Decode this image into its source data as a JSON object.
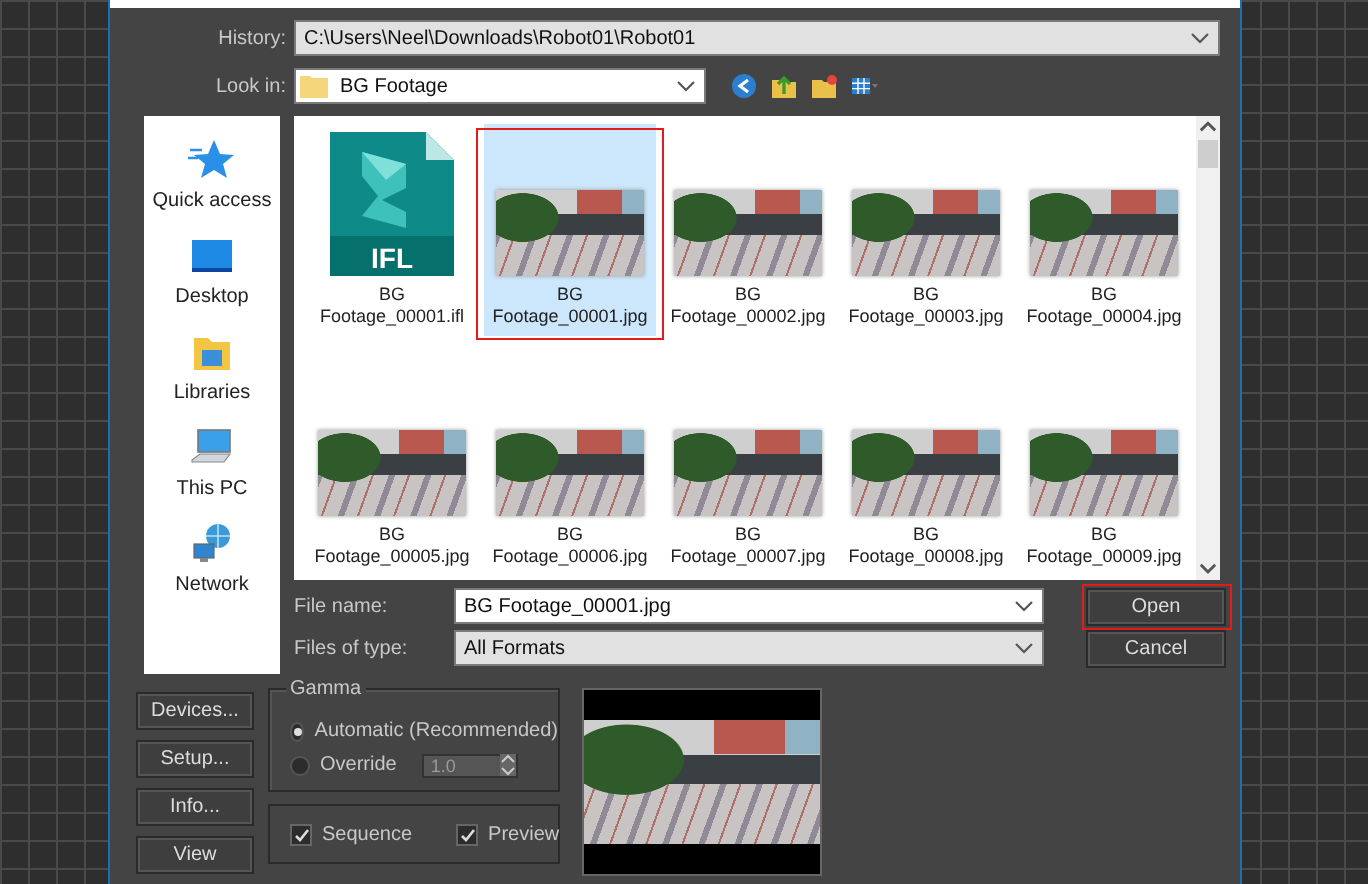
{
  "history": {
    "label": "History:",
    "value": "C:\\Users\\Neel\\Downloads\\Robot01\\Robot01"
  },
  "look_in": {
    "label": "Look in:",
    "value": "BG Footage"
  },
  "places": [
    {
      "kind": "star",
      "label": "Quick access"
    },
    {
      "kind": "desktop",
      "label": "Desktop"
    },
    {
      "kind": "libraries",
      "label": "Libraries"
    },
    {
      "kind": "pc",
      "label": "This PC"
    },
    {
      "kind": "network",
      "label": "Network"
    }
  ],
  "files": [
    {
      "kind": "ifl",
      "badge": "IFL",
      "name": "BG Footage_00001.ifl",
      "selected": false,
      "annotated": false
    },
    {
      "kind": "image",
      "name": "BG Footage_00001.jpg",
      "selected": true,
      "annotated": true
    },
    {
      "kind": "image",
      "name": "BG Footage_00002.jpg",
      "selected": false,
      "annotated": false
    },
    {
      "kind": "image",
      "name": "BG Footage_00003.jpg",
      "selected": false,
      "annotated": false
    },
    {
      "kind": "image",
      "name": "BG Footage_00004.jpg",
      "selected": false,
      "annotated": false
    },
    {
      "kind": "image",
      "name": "BG Footage_00005.jpg",
      "selected": false,
      "annotated": false
    },
    {
      "kind": "image",
      "name": "BG Footage_00006.jpg",
      "selected": false,
      "annotated": false
    },
    {
      "kind": "image",
      "name": "BG Footage_00007.jpg",
      "selected": false,
      "annotated": false
    },
    {
      "kind": "image",
      "name": "BG Footage_00008.jpg",
      "selected": false,
      "annotated": false
    },
    {
      "kind": "image",
      "name": "BG Footage_00009.jpg",
      "selected": false,
      "annotated": false
    }
  ],
  "file_name": {
    "label": "File name:",
    "value": "BG Footage_00001.jpg"
  },
  "file_type": {
    "label": "Files of type:",
    "value": "All Formats"
  },
  "buttons": [
    {
      "label": "Open",
      "annotated": true
    },
    {
      "label": "Cancel",
      "annotated": false
    }
  ],
  "side_buttons": [
    "Devices...",
    "Setup...",
    "Info...",
    "View"
  ],
  "gamma": {
    "title": "Gamma",
    "options": [
      {
        "label": "Automatic (Recommended)",
        "selected": true
      },
      {
        "label": "Override",
        "selected": false
      }
    ],
    "override_value": "1.0"
  },
  "checks": [
    {
      "label": "Sequence",
      "checked": true
    },
    {
      "label": "Preview",
      "checked": true
    }
  ]
}
